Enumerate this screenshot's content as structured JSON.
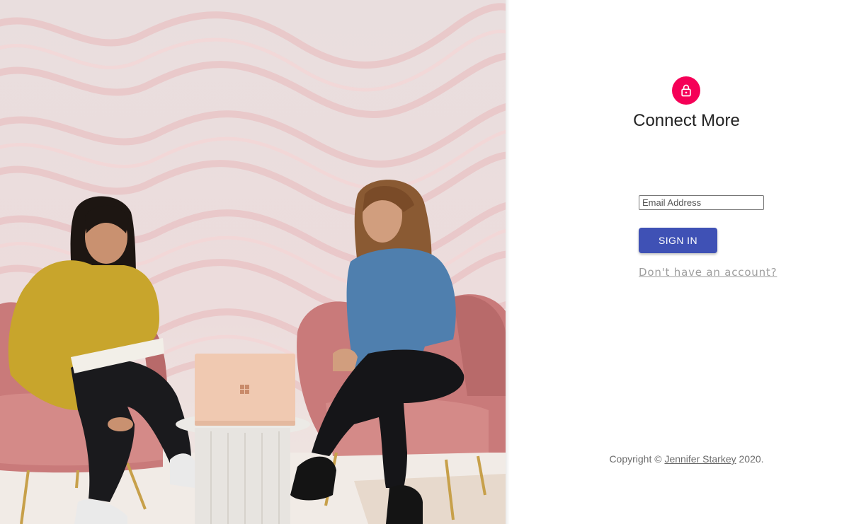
{
  "hero": {
    "icon": "windows-logo-icon"
  },
  "signin": {
    "lock_icon": "lock-icon",
    "accent_color": "#f50057",
    "title": "Connect More",
    "email_placeholder": "Email Address",
    "submit_label": "SIGN IN",
    "button_color": "#3f51b5",
    "signup_link": "Don't have an account?"
  },
  "footer": {
    "copyright_prefix": "Copyright © ",
    "author": "Jennifer Starkey",
    "copyright_suffix": " 2020."
  }
}
